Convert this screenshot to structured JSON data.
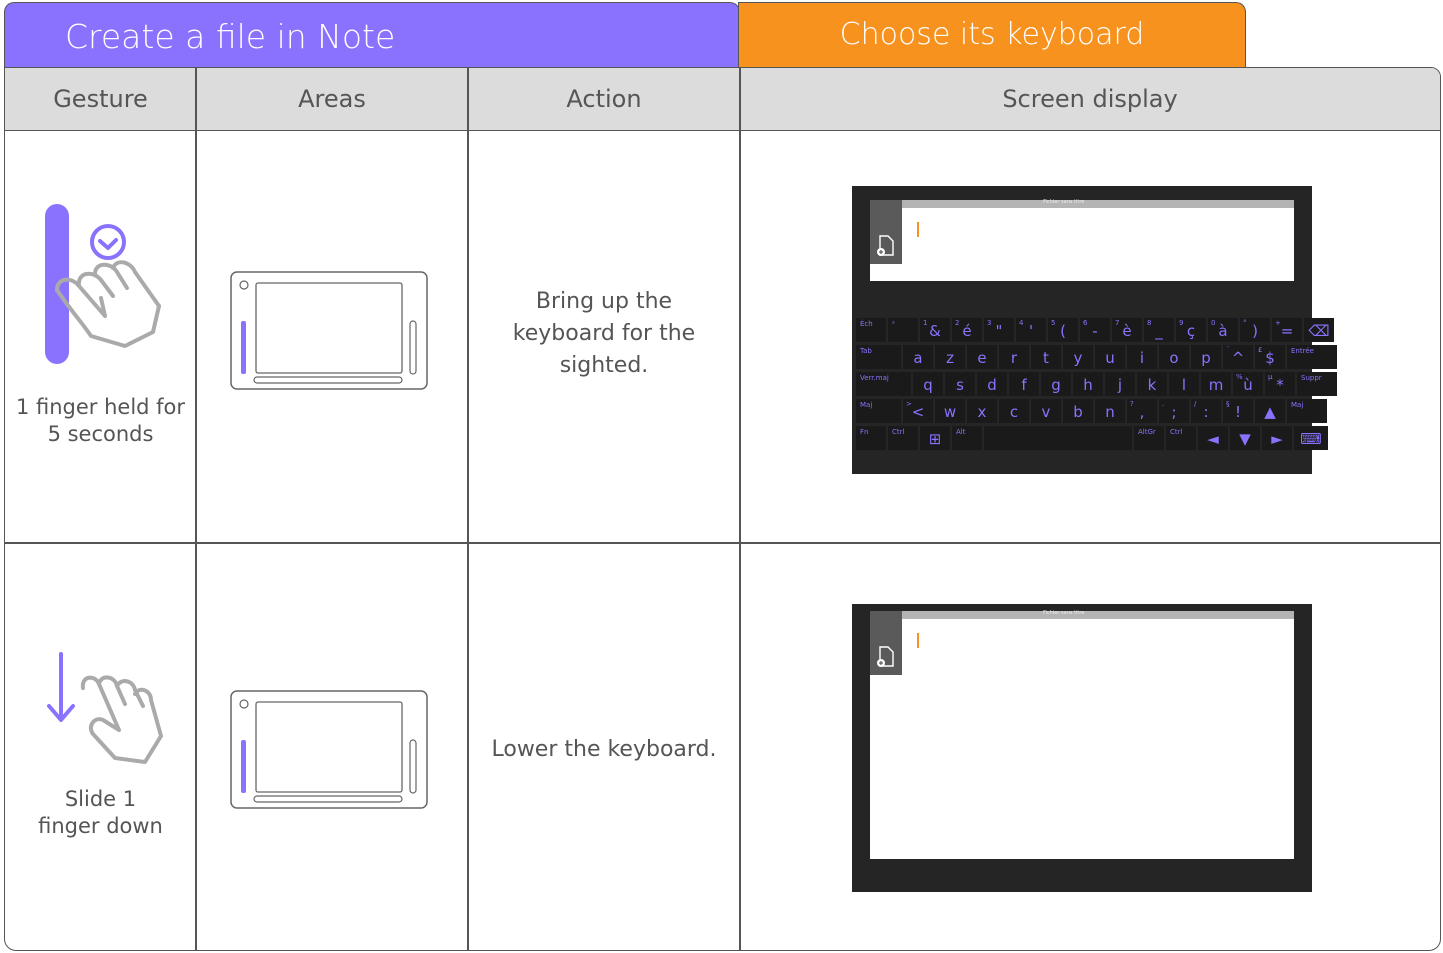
{
  "tabs": {
    "left": "Create a file in Note",
    "right": "Choose its keyboard"
  },
  "headers": [
    "Gesture",
    "Areas",
    "Action",
    "Screen display"
  ],
  "rows": [
    {
      "gesture_caption": "1 finger held for\n5 seconds",
      "action": "Bring up the\nkeyboard for the\nsighted.",
      "screen": {
        "header_text": "Fichier sans titre"
      }
    },
    {
      "gesture_caption": "Slide 1\nfinger down",
      "action": "Lower the keyboard.",
      "screen": {
        "header_text": "Fichier sans titre"
      }
    }
  ],
  "keyboard": {
    "rows": [
      [
        {
          "s": "Éch"
        },
        {
          "s": "²"
        },
        {
          "s": "1",
          "p": "&"
        },
        {
          "s": "2",
          "p": "é"
        },
        {
          "s": "3",
          "p": "\""
        },
        {
          "s": "4",
          "p": "'"
        },
        {
          "s": "5",
          "p": "("
        },
        {
          "s": "6",
          "p": "-"
        },
        {
          "s": "7",
          "p": "è"
        },
        {
          "s": "8",
          "p": "_"
        },
        {
          "s": "9",
          "p": "ç"
        },
        {
          "s": "0",
          "p": "à"
        },
        {
          "s": "°",
          "p": ")"
        },
        {
          "s": "+",
          "p": "="
        },
        {
          "p": "⌫"
        }
      ],
      [
        {
          "s": "Tab"
        },
        {
          "p": "a"
        },
        {
          "p": "z"
        },
        {
          "p": "e"
        },
        {
          "p": "r"
        },
        {
          "p": "t"
        },
        {
          "p": "y"
        },
        {
          "p": "u"
        },
        {
          "p": "i"
        },
        {
          "p": "o"
        },
        {
          "p": "p"
        },
        {
          "s": "¨",
          "p": "^"
        },
        {
          "s": "£",
          "p": "$"
        },
        {
          "s": "Entrée"
        }
      ],
      [
        {
          "s": "Verr.maj"
        },
        {
          "p": "q"
        },
        {
          "p": "s"
        },
        {
          "p": "d"
        },
        {
          "p": "f"
        },
        {
          "p": "g"
        },
        {
          "p": "h"
        },
        {
          "p": "j"
        },
        {
          "p": "k"
        },
        {
          "p": "l"
        },
        {
          "p": "m"
        },
        {
          "s": "%",
          "p": "ù"
        },
        {
          "s": "µ",
          "p": "*"
        },
        {
          "s": "Suppr"
        }
      ],
      [
        {
          "s": "Maj"
        },
        {
          "s": ">",
          "p": "<"
        },
        {
          "p": "w"
        },
        {
          "p": "x"
        },
        {
          "p": "c"
        },
        {
          "p": "v"
        },
        {
          "p": "b"
        },
        {
          "p": "n"
        },
        {
          "s": "?",
          "p": ","
        },
        {
          "s": ".",
          "p": ";"
        },
        {
          "s": "/",
          "p": ":"
        },
        {
          "s": "§",
          "p": "!"
        },
        {
          "p": "▲"
        },
        {
          "s": "Maj"
        }
      ],
      [
        {
          "s": "Fn"
        },
        {
          "s": "Ctrl"
        },
        {
          "p": "⊞"
        },
        {
          "s": "Alt"
        },
        {
          "p": ""
        },
        {
          "s": "AltGr"
        },
        {
          "s": "Ctrl"
        },
        {
          "p": "◄"
        },
        {
          "p": "▼"
        },
        {
          "p": "►"
        },
        {
          "p": "⌨"
        }
      ]
    ]
  },
  "colors": {
    "purple": "#8a72ff",
    "orange": "#f7921e",
    "header_gray": "#dcdcdc",
    "screen_dark": "#252525"
  },
  "icons": {
    "gesture_1": "hand-hold-clock-icon",
    "gesture_2": "hand-slide-down-icon",
    "areas": "tablet-areas-icon",
    "new_file": "new-file-icon"
  }
}
